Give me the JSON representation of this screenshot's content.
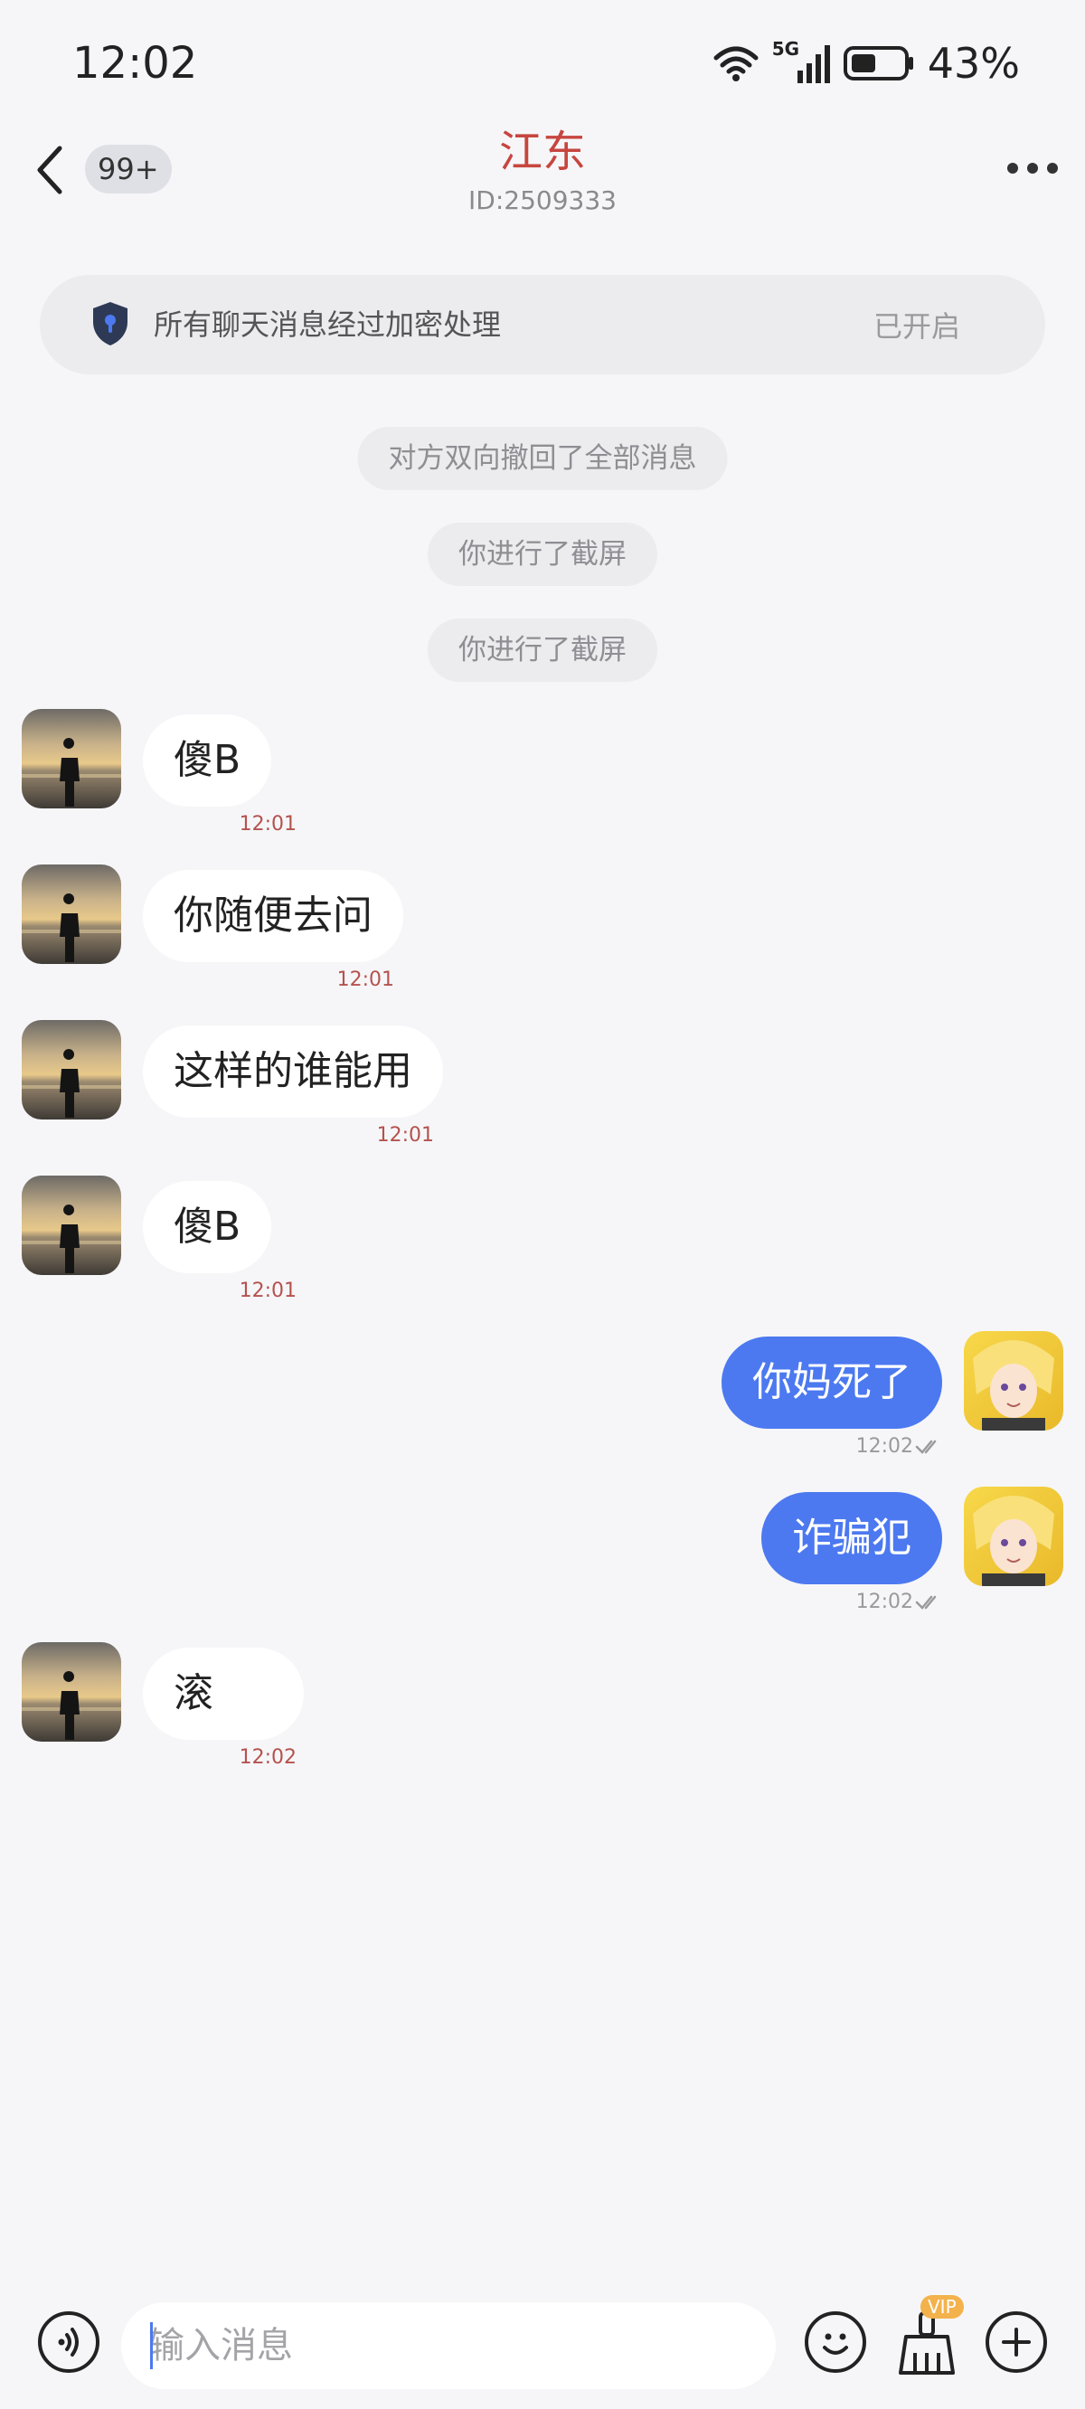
{
  "status_bar": {
    "time": "12:02",
    "network": "5G",
    "battery": "43%",
    "icons": [
      "wifi-icon",
      "signal-icon",
      "battery-icon"
    ]
  },
  "header": {
    "unread_badge": "99+",
    "title": "江东",
    "subtitle": "ID:2509333",
    "icons": [
      "back-icon",
      "more-icon"
    ]
  },
  "encryption": {
    "text": "所有聊天消息经过加密处理",
    "status": "已开启",
    "icon": "shield-icon"
  },
  "notices": [
    "对方双向撤回了全部消息",
    "你进行了截屏",
    "你进行了截屏"
  ],
  "messages": [
    {
      "side": "in",
      "text": "傻B",
      "time": "12:01"
    },
    {
      "side": "in",
      "text": "你随便去问",
      "time": "12:01"
    },
    {
      "side": "in",
      "text": "这样的谁能用",
      "time": "12:01"
    },
    {
      "side": "in",
      "text": "傻B",
      "time": "12:01"
    },
    {
      "side": "out",
      "text": "你妈死了",
      "time": "12:02",
      "read": true
    },
    {
      "side": "out",
      "text": "诈骗犯",
      "time": "12:02",
      "read": true
    },
    {
      "side": "in",
      "text": "滚",
      "time": "12:02"
    }
  ],
  "input_bar": {
    "placeholder": "输入消息",
    "vip_label": "VIP",
    "icons": [
      "voice-icon",
      "emoji-icon",
      "clean-icon",
      "add-icon"
    ]
  },
  "colors": {
    "accent": "#4c79f0",
    "title": "#c6463f",
    "background": "#f6f6f8"
  }
}
